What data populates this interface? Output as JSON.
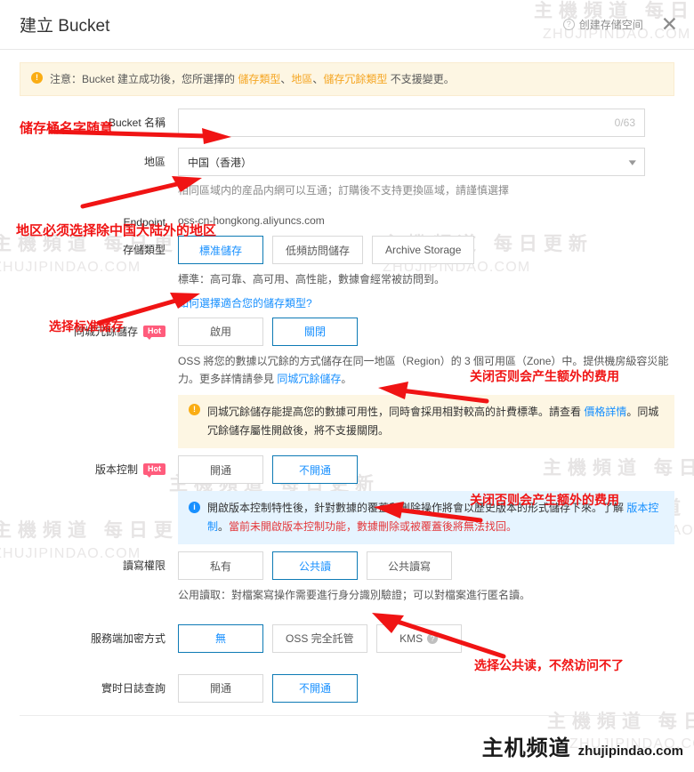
{
  "header": {
    "title": "建立 Bucket",
    "help_label": "创建存储空间",
    "help_icon": "question-circle-icon",
    "close_icon": "close-icon"
  },
  "notice": {
    "icon": "warning-icon",
    "prefix": "注意：Bucket 建立成功後，您所選擇的 ",
    "hl1": "儲存類型",
    "sep1": "、",
    "hl2": "地區",
    "sep2": "、",
    "hl3": "儲存冗餘類型",
    "suffix": " 不支援變更。"
  },
  "form": {
    "bucket_name": {
      "label": "Bucket 名稱",
      "value": "",
      "placeholder": "",
      "counter": "0/63"
    },
    "region": {
      "label": "地區",
      "value": "中国（香港）",
      "chevron_icon": "chevron-down-icon",
      "hint": "相同區域内的産品内網可以互通；訂購後不支持更換區域，請謹慎選擇"
    },
    "endpoint": {
      "label": "Endpoint",
      "value": "oss-cn-hongkong.aliyuncs.com"
    },
    "storage_class": {
      "label": "存儲類型",
      "options": [
        "標准儲存",
        "低頻訪問儲存",
        "Archive Storage"
      ],
      "selected": "標准儲存",
      "desc": "標準：高可靠、高可用、高性能，數據會經常被訪問到。",
      "link": "如何選擇適合您的儲存類型?"
    },
    "zone_redundancy": {
      "label": "同城冗餘儲存",
      "badge": "Hot",
      "options": [
        "啟用",
        "關閉"
      ],
      "selected": "關閉",
      "desc_1": "OSS 將您的數據以冗餘的方式儲存在同一地區（Region）的 3 個可用區（Zone）中。提供機房級容災能力。更多詳情請參見 ",
      "desc_link": "同城冗餘儲存",
      "desc_2": "。",
      "panel_icon": "warning-icon",
      "panel_1": "同城冗餘儲存能提高您的數據可用性，同時會採用相對較高的計費標準。請查看 ",
      "panel_link": "價格詳情",
      "panel_2": "。同城冗餘儲存屬性開啟後，將不支援關閉。"
    },
    "versioning": {
      "label": "版本控制",
      "badge": "Hot",
      "options": [
        "開通",
        "不開通"
      ],
      "selected": "不開通",
      "panel_icon": "info-icon",
      "panel_1": "開啟版本控制特性後，針對數據的覆蓋和刪除操作將會以歷史版本的形式儲存下來。了解 ",
      "panel_link": "版本控制",
      "panel_2": "。",
      "panel_red": "當前未開啟版本控制功能，數據刪除或被覆蓋後將無法找回。"
    },
    "acl": {
      "label": "讀寫權限",
      "options": [
        "私有",
        "公共讀",
        "公共讀寫"
      ],
      "selected": "公共讀",
      "desc": "公用讀取：對檔案寫操作需要進行身分識別驗證；可以對檔案進行匿名讀。"
    },
    "encryption": {
      "label": "服務端加密方式",
      "options": [
        "無",
        "OSS 完全託管",
        "KMS"
      ],
      "selected": "無",
      "kms_help_icon": "question-circle-icon"
    },
    "realtime_log": {
      "label": "實时日誌查詢",
      "options": [
        "開通",
        "不開通"
      ],
      "selected": "不開通"
    }
  },
  "annotations": [
    {
      "name": "annotation-bucket-name",
      "text": "储存桶名字随意"
    },
    {
      "name": "annotation-region",
      "text": "地区必须选择除中国大陆外的地区"
    },
    {
      "name": "annotation-storage-class",
      "text": "选择标准储存"
    },
    {
      "name": "annotation-zone-redundancy",
      "text": "关闭否则会产生额外的费用"
    },
    {
      "name": "annotation-versioning",
      "text": "关闭否则会产生额外的费用"
    },
    {
      "name": "annotation-acl",
      "text": "选择公共读，不然访问不了"
    }
  ],
  "watermarks": {
    "cn": "主機頻道 每日更新",
    "en": "ZHUJIPINDAO.COM",
    "brand_cn": "主机频道",
    "brand_en": "zhujipindao.com"
  },
  "colors": {
    "accent": "#1890ff",
    "selected_border": "#0d7ab5",
    "annotation": "#f01414",
    "hot_badge": "#ff5c7c",
    "warn_bg": "#fdf6e3",
    "info_bg": "#e6f4ff"
  }
}
